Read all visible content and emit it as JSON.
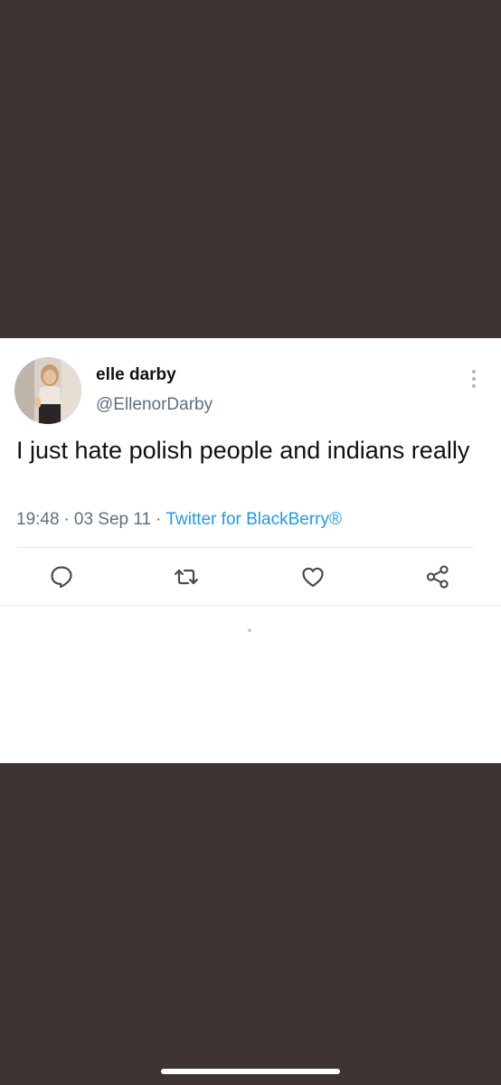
{
  "tweet": {
    "display_name": "elle darby",
    "handle": "@EllenorDarby",
    "text": "I just hate polish people and indians really",
    "time": "19:48",
    "date": "03 Sep 11",
    "source": "Twitter for BlackBerry®",
    "separator": "·"
  },
  "icons": {
    "more": "more-vertical-icon",
    "reply": "reply-icon",
    "retweet": "retweet-icon",
    "like": "heart-icon",
    "share": "share-icon"
  },
  "colors": {
    "background": "#3e3433",
    "card": "#ffffff",
    "text": "#111111",
    "secondary": "#5b7083",
    "link": "#1d9bf0",
    "icon": "#4a4a4a"
  }
}
